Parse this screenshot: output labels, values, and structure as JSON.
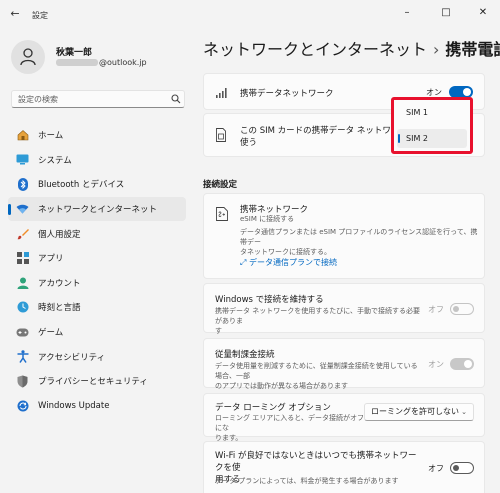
{
  "window": {
    "title": "設定",
    "back_label": "←",
    "minimize_label": "–",
    "maximize_label": "□",
    "close_label": "✕"
  },
  "user": {
    "name": "秋葉一郎",
    "email": "@outlook.jp"
  },
  "search": {
    "placeholder": "設定の検索"
  },
  "sidebar": {
    "items": [
      {
        "label": "ホーム",
        "icon": "home-icon"
      },
      {
        "label": "システム",
        "icon": "system-icon"
      },
      {
        "label": "Bluetooth とデバイス",
        "icon": "bluetooth-icon"
      },
      {
        "label": "ネットワークとインターネット",
        "icon": "network-icon",
        "active": true
      },
      {
        "label": "個人用設定",
        "icon": "brush-icon"
      },
      {
        "label": "アプリ",
        "icon": "apps-icon"
      },
      {
        "label": "アカウント",
        "icon": "account-icon"
      },
      {
        "label": "時刻と言語",
        "icon": "clock-icon"
      },
      {
        "label": "ゲーム",
        "icon": "gamepad-icon"
      },
      {
        "label": "アクセシビリティ",
        "icon": "accessibility-icon"
      },
      {
        "label": "プライバシーとセキュリティ",
        "icon": "shield-icon"
      },
      {
        "label": "Windows Update",
        "icon": "update-icon"
      }
    ]
  },
  "breadcrumb": {
    "parent": "ネットワークとインターネット",
    "separator": "›",
    "current": "携帯電話"
  },
  "cellular": {
    "title": "携帯データネットワーク",
    "toggle_label": "オン",
    "sim_card_text_1": "この SIM カードの携帯データ ネットワークを",
    "sim_card_text_2": "使う"
  },
  "sim_dropdown": {
    "options": [
      "SIM 1",
      "SIM 2"
    ],
    "selected": "SIM 2"
  },
  "connection_settings": {
    "section_title": "接続設定",
    "network_title": "携帯ネットワーク",
    "network_subtitle": "eSIM に接続する",
    "network_desc_1": "データ通信プランまたは eSIM プロファイルのライセンス認証を行って、携帯デー",
    "network_desc_2": "タネットワークに接続する。",
    "connect_link": "データ通信プランで接続"
  },
  "settings": {
    "stay_connected_title": "Windows で接続を維持する",
    "stay_connected_desc": "携帯データ ネットワークを使用するたびに、手動で接続する必要がありま",
    "stay_connected_desc_2": "す",
    "stay_connected_state": "オフ",
    "metered_title": "従量制課金接続",
    "metered_desc_1": "データ使用量を削減するために、従量制課金接続を使用している場合、一部",
    "metered_desc_2": "のアプリでは動作が異なる場合があります",
    "metered_state": "オン",
    "roaming_title": "データ ローミング オプション",
    "roaming_desc_1": "ローミング エリアに入ると、データ接続がオフにな",
    "roaming_desc_2": "ります。",
    "roaming_value": "ローミングを許可しない",
    "wifi_title_1": "Wi-Fi が良好ではないときはいつでも携帯ネットワークを使",
    "wifi_title_2": "用する",
    "wifi_desc": "データ プランによっては、料金が発生する場合があります",
    "wifi_state": "オフ"
  },
  "colors": {
    "accent": "#0067c0",
    "highlight_border": "#e8112d"
  }
}
